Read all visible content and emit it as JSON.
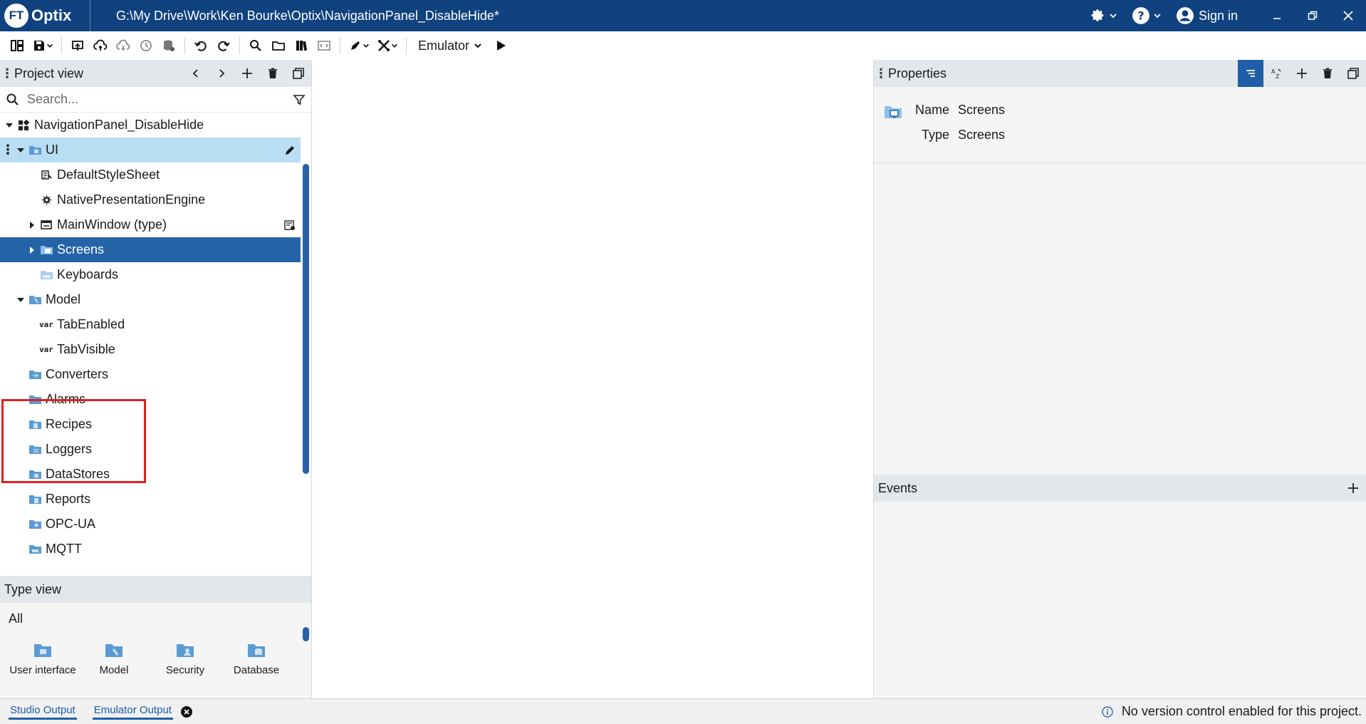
{
  "titlebar": {
    "logo_ft": "FT",
    "logo_name": "Optix",
    "path": "G:\\My Drive\\Work\\Ken Bourke\\Optix\\NavigationPanel_DisableHide*",
    "signin_label": "Sign in"
  },
  "toolbar": {
    "emulator_label": "Emulator"
  },
  "project_view": {
    "title": "Project view",
    "search_placeholder": "Search...",
    "tree": [
      {
        "label": "NavigationPanel_DisableHide",
        "icon": "project-icon"
      },
      {
        "label": "UI",
        "icon": "folder-icon"
      },
      {
        "label": "DefaultStyleSheet",
        "icon": "stylesheet-icon"
      },
      {
        "label": "NativePresentationEngine",
        "icon": "gear-icon"
      },
      {
        "label": "MainWindow (type)",
        "icon": "window-icon"
      },
      {
        "label": "Screens",
        "icon": "screens-folder-icon"
      },
      {
        "label": "Keyboards",
        "icon": "folder-icon"
      },
      {
        "label": "Model",
        "icon": "model-folder-icon"
      },
      {
        "label": "TabEnabled",
        "icon": "var-icon"
      },
      {
        "label": "TabVisible",
        "icon": "var-icon"
      },
      {
        "label": "Converters",
        "icon": "folder-icon"
      },
      {
        "label": "Alarms",
        "icon": "folder-icon"
      },
      {
        "label": "Recipes",
        "icon": "folder-icon"
      },
      {
        "label": "Loggers",
        "icon": "folder-icon"
      },
      {
        "label": "DataStores",
        "icon": "folder-icon"
      },
      {
        "label": "Reports",
        "icon": "folder-icon"
      },
      {
        "label": "OPC-UA",
        "icon": "folder-icon"
      },
      {
        "label": "MQTT",
        "icon": "folder-icon"
      }
    ],
    "var_badge": "var"
  },
  "type_view": {
    "title": "Type view",
    "filter": "All",
    "items": [
      {
        "label": "User interface"
      },
      {
        "label": "Model"
      },
      {
        "label": "Security"
      },
      {
        "label": "Database"
      }
    ]
  },
  "properties": {
    "title": "Properties",
    "name_key": "Name",
    "name_value": "Screens",
    "type_key": "Type",
    "type_value": "Screens"
  },
  "events": {
    "title": "Events"
  },
  "statusbar": {
    "tab_studio": "Studio Output",
    "tab_emulator": "Emulator Output",
    "message": "No version control enabled for this project."
  },
  "colors": {
    "titlebar": "#10427f",
    "selection": "#2563a7",
    "selection_light": "#b9ddf3",
    "highlight_box": "#e02020",
    "folder": "#5b9bd5"
  }
}
